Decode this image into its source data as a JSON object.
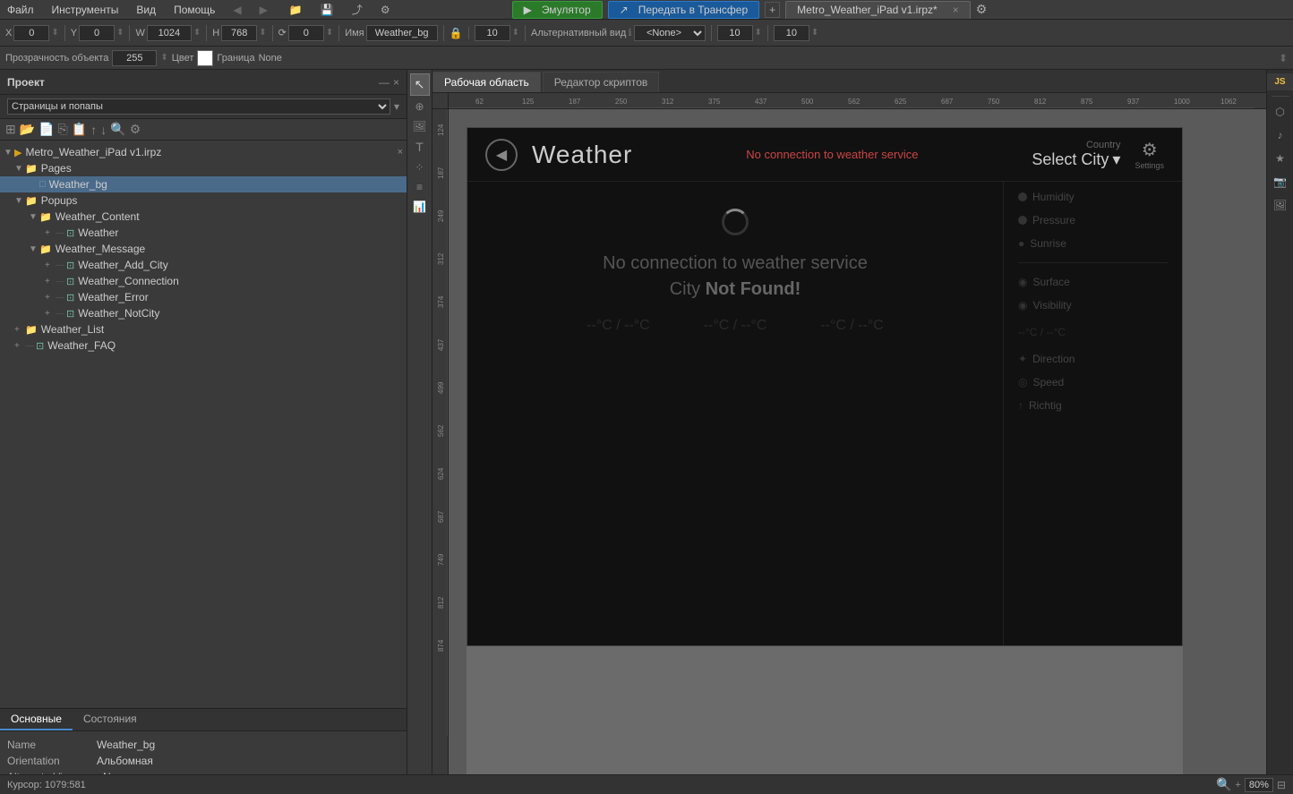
{
  "menubar": {
    "items": [
      "Файл",
      "Инструменты",
      "Вид",
      "Помощь"
    ]
  },
  "toolbar1": {
    "x_label": "X",
    "x_value": "0",
    "y_label": "Y",
    "y_value": "0",
    "w_label": "W",
    "w_value": "1024",
    "h_label": "H",
    "h_value": "768",
    "angle_value": "0",
    "name_value": "Weather_bg",
    "padding_value": "10",
    "alt_view_label": "Альтернативный вид",
    "none_option": "<None>",
    "padding2_value": "10",
    "padding3_value": "10",
    "emulator_label": "Эмулятор",
    "transfer_label": "Передать в Трансфер",
    "file_tab": "Metro_Weather_iPad v1.irpz*"
  },
  "toolbar2": {
    "opacity_label": "Прозрачность объекта",
    "opacity_value": "255",
    "color_label": "Цвет",
    "border_label": "Граница",
    "border_value": "None"
  },
  "project": {
    "title": "Проект",
    "sections_label": "Страницы и попапы",
    "file_name": "Metro_Weather_iPad v1.irpz",
    "pages_folder": "Pages",
    "weather_bg": "Weather_bg",
    "popups_folder": "Popups",
    "weather_content": "Weather_Content",
    "weather_widget": "Weather",
    "weather_message": "Weather_Message",
    "weather_add_city": "Weather_Add_City",
    "weather_connection": "Weather_Connection",
    "weather_error": "Weather_Error",
    "weather_not_city": "Weather_NotCity",
    "weather_list": "Weather_List",
    "weather_faq": "Weather_FAQ"
  },
  "properties": {
    "tabs": {
      "basic": "Основные",
      "states": "Состояния"
    },
    "name_label": "Name",
    "name_value": "Weather_bg",
    "orientation_label": "Orientation",
    "orientation_value": "Альбомная",
    "alternate_label": "Alternate View",
    "alternate_value": "<None>"
  },
  "work_tabs": {
    "working_area": "Рабочая область",
    "script_editor": "Редактор скриптов"
  },
  "canvas": {
    "zoom_value": "80%",
    "cursor_pos": "Курсор: 1079:581"
  },
  "weather_app": {
    "back_icon": "◀",
    "title": "Weather",
    "error_text": "No connection to weather service",
    "country_label": "Country",
    "city_label": "Select City",
    "city_dropdown_arrow": "▾",
    "settings_icon": "⚙",
    "settings_label": "Settings",
    "no_connection_text": "No connection to weather service",
    "city_not_found": "City Not Found!",
    "temp_placeholder": "--°C / --°C",
    "metrics": {
      "humidity": "Humidity",
      "pressure": "Pressure",
      "sunrise": "Sunrise",
      "sunrise_icon": "●",
      "surface": "Surface",
      "visibility": "Visibility",
      "visibility_icon": "◉",
      "direction": "Direction",
      "direction_icon": "✦",
      "speed": "Speed",
      "speed_icon": "◎",
      "richtig": "Richtig",
      "richtig_icon": "↑"
    }
  },
  "ruler_marks": [
    "62",
    "125",
    "187",
    "250",
    "312",
    "375",
    "437",
    "500",
    "562",
    "625",
    "687",
    "750",
    "812",
    "875",
    "937",
    "1000",
    "1062"
  ],
  "ruler_marks_v": [
    "124",
    "187",
    "249",
    "312",
    "374",
    "437",
    "499",
    "562",
    "624",
    "687",
    "749",
    "812",
    "874"
  ],
  "right_panel_icons": [
    "▶",
    "⬡",
    "♪",
    "★",
    "⬒"
  ],
  "status": {
    "cursor_label": "Курсор:",
    "cursor_value": "1079:581",
    "zoom": "80%"
  }
}
